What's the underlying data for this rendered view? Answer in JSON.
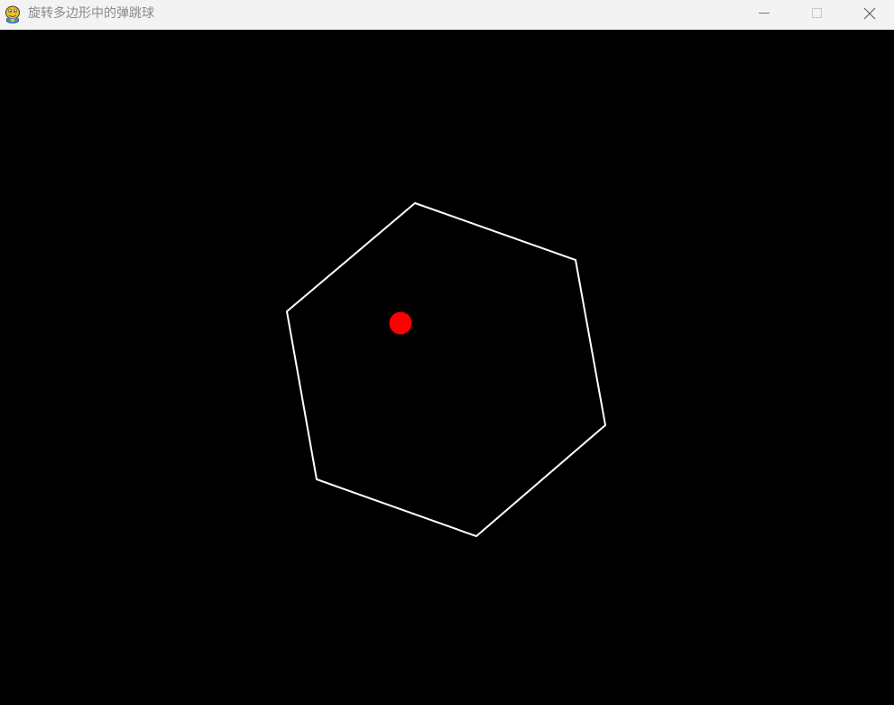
{
  "window": {
    "title": "旋转多边形中的弹跳球",
    "app_icon": "pygame-snake-icon",
    "controls": {
      "minimize_icon": "minimize-icon",
      "maximize_icon": "maximize-icon",
      "close_icon": "close-icon"
    }
  },
  "scene": {
    "background_color": "#000000",
    "polygon": {
      "sides": 6,
      "stroke_color": "#ffffff"
    },
    "ball": {
      "color": "#ff0000"
    }
  }
}
